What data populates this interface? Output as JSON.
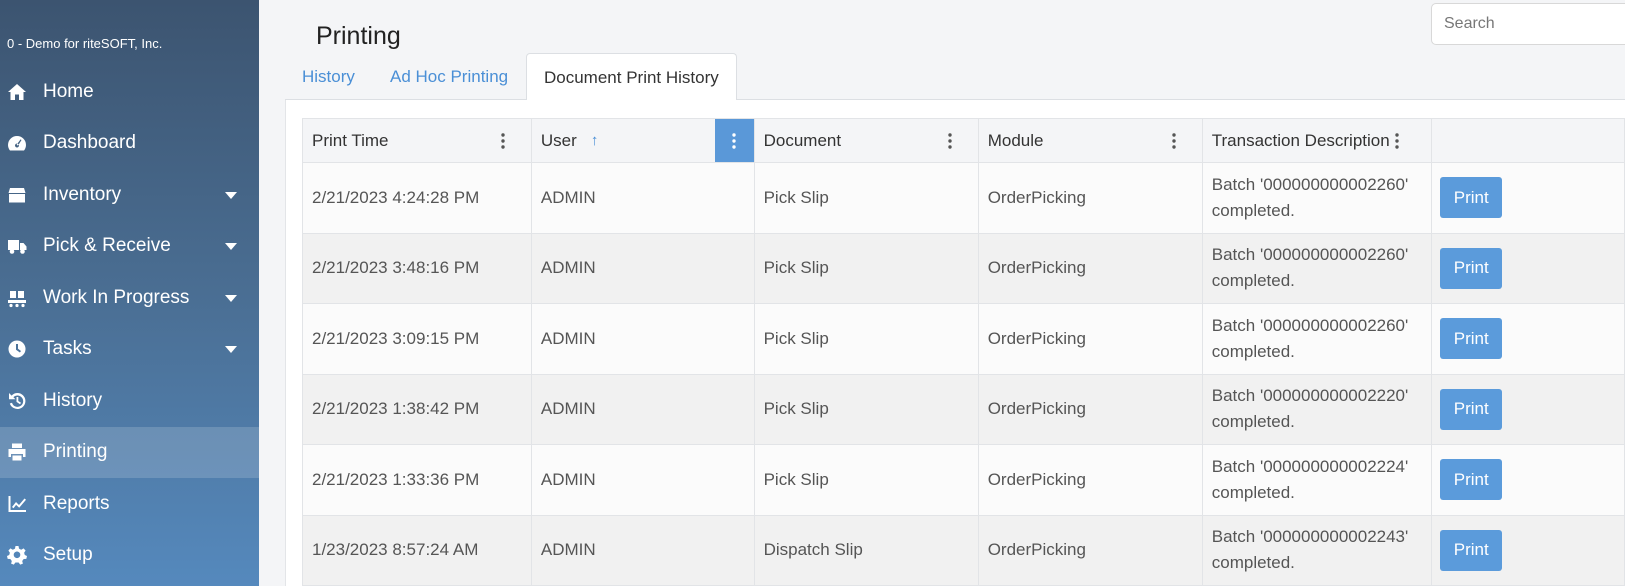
{
  "sidebar": {
    "company": "0 - Demo for riteSOFT, Inc.",
    "items": [
      {
        "label": "Home",
        "icon": "home-icon"
      },
      {
        "label": "Dashboard",
        "icon": "dashboard-icon"
      },
      {
        "label": "Inventory",
        "icon": "box-icon"
      },
      {
        "label": "Pick & Receive",
        "icon": "truck-icon"
      },
      {
        "label": "Work In Progress",
        "icon": "conveyor-icon"
      },
      {
        "label": "Tasks",
        "icon": "clock-icon"
      },
      {
        "label": "History",
        "icon": "history-icon"
      },
      {
        "label": "Printing",
        "icon": "printer-icon"
      },
      {
        "label": "Reports",
        "icon": "chart-icon"
      },
      {
        "label": "Setup",
        "icon": "gear-icon"
      }
    ],
    "active_item": "Printing",
    "colors": {
      "top": "#3c5470",
      "bottom": "#5589bd"
    }
  },
  "header": {
    "title": "Printing",
    "search_placeholder": "Search"
  },
  "tabs": [
    {
      "label": "History"
    },
    {
      "label": "Ad Hoc Printing"
    },
    {
      "label": "Document Print History"
    }
  ],
  "active_tab": "Document Print History",
  "table": {
    "columns": [
      "Print Time",
      "User",
      "Document",
      "Module",
      "Transaction Description",
      ""
    ],
    "sorted_column": "User",
    "sort_direction": "ascending",
    "rows": [
      {
        "print_time": "2/21/2023 4:24:28 PM",
        "user": "ADMIN",
        "document": "Pick Slip",
        "module": "OrderPicking",
        "description": "Batch '000000000002260' completed.",
        "action": "Print"
      },
      {
        "print_time": "2/21/2023 3:48:16 PM",
        "user": "ADMIN",
        "document": "Pick Slip",
        "module": "OrderPicking",
        "description": "Batch '000000000002260' completed.",
        "action": "Print"
      },
      {
        "print_time": "2/21/2023 3:09:15 PM",
        "user": "ADMIN",
        "document": "Pick Slip",
        "module": "OrderPicking",
        "description": "Batch '000000000002260' completed.",
        "action": "Print"
      },
      {
        "print_time": "2/21/2023 1:38:42 PM",
        "user": "ADMIN",
        "document": "Pick Slip",
        "module": "OrderPicking",
        "description": "Batch '000000000002220' completed.",
        "action": "Print"
      },
      {
        "print_time": "2/21/2023 1:33:36 PM",
        "user": "ADMIN",
        "document": "Pick Slip",
        "module": "OrderPicking",
        "description": "Batch '000000000002224' completed.",
        "action": "Print"
      },
      {
        "print_time": "1/23/2023 8:57:24 AM",
        "user": "ADMIN",
        "document": "Dispatch Slip",
        "module": "OrderPicking",
        "description": "Batch '000000000002243' completed.",
        "action": "Print"
      }
    ]
  },
  "colors": {
    "accent": "#5b9bdb",
    "link": "#4a8fd6"
  }
}
